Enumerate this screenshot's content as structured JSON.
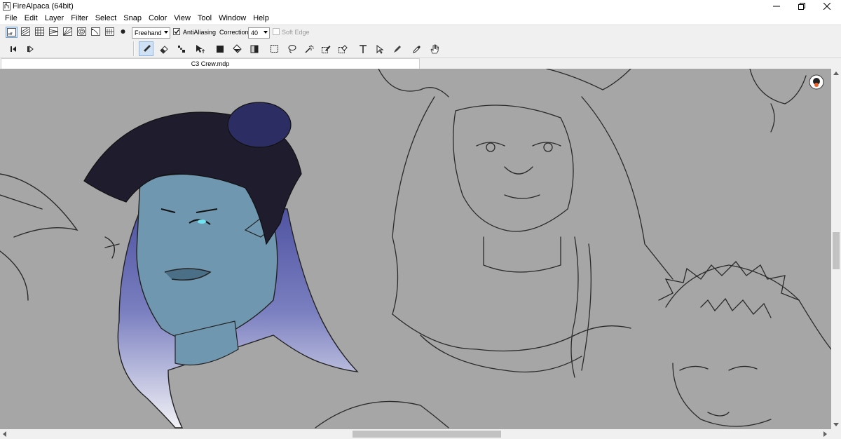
{
  "window": {
    "title": "FireAlpaca (64bit)",
    "icons": [
      "app-icon",
      "minimize-icon",
      "restore-icon",
      "close-icon"
    ]
  },
  "menu": [
    "File",
    "Edit",
    "Layer",
    "Filter",
    "Select",
    "Snap",
    "Color",
    "View",
    "Tool",
    "Window",
    "Help"
  ],
  "options": {
    "brush_mode": "Freehand",
    "antialiasing_label": "AntiAliasing",
    "antialiasing_checked": true,
    "correction_label": "Correction",
    "correction_value": "40",
    "soft_edge_label": "Soft Edge",
    "soft_edge_checked": false
  },
  "tabs": [
    {
      "label": "C3 Crew.mdp"
    }
  ],
  "colors": {
    "canvas_bg": "#a6a6a6",
    "skin": "#6f98b0",
    "hair_dark": "#1f1c2e",
    "hair_gradient_top": "#4a4e9e",
    "hair_gradient_bottom": "#f2f2f6",
    "accent_active": "#cfe1f5"
  }
}
